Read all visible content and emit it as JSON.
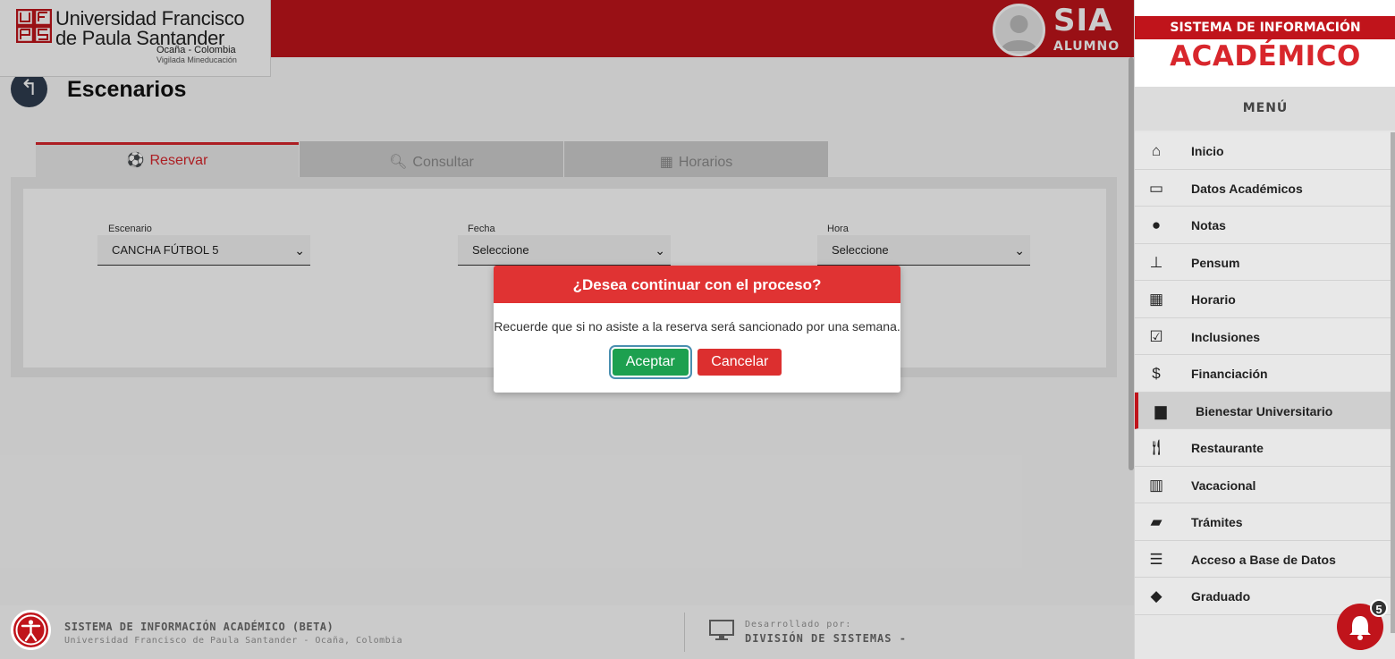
{
  "header": {
    "logo_lines": [
      "Universidad Francisco",
      "de Paula Santander",
      "Ocaña - Colombia",
      "Vigilada Mineducación"
    ],
    "logo_mark": "UFPS",
    "app_name": "SIA",
    "app_role": "ALUMNO",
    "brand_red": "#c0141b"
  },
  "page": {
    "title": "Escenarios",
    "tabs": [
      {
        "label": "Reservar",
        "icon": "soccer-ball-icon",
        "active": true
      },
      {
        "label": "Consultar",
        "icon": "search-icon",
        "active": false
      },
      {
        "label": "Horarios",
        "icon": "calendar-icon",
        "active": false
      }
    ],
    "form": {
      "escenario": {
        "label": "Escenario",
        "value": "CANCHA FÚTBOL 5"
      },
      "fecha": {
        "label": "Fecha",
        "value": "Seleccione"
      },
      "hora": {
        "label": "Hora",
        "value": "Seleccione"
      }
    }
  },
  "modal": {
    "title": "¿Desea continuar con el proceso?",
    "message": "Recuerde que si no asiste a la reserva será sancionado por una semana.",
    "accept_label": "Aceptar",
    "cancel_label": "Cancelar",
    "accept_color": "#1da04f",
    "cancel_color": "#dc2f2f"
  },
  "footer": {
    "title": "SISTEMA DE INFORMACIÓN ACADÉMICO (BETA)",
    "subtitle": "Universidad Francisco de Paula Santander - Ocaña, Colombia",
    "dev_label": "Desarrollado por:",
    "dev_name": "DIVISIÓN DE SISTEMAS -"
  },
  "sidebar": {
    "system_title": "SISTEMA DE INFORMACIÓN",
    "system_sub": "ACADÉMICO",
    "menu_title": "MENÚ",
    "items": [
      {
        "label": "Inicio",
        "icon": "home-icon"
      },
      {
        "label": "Datos Académicos",
        "icon": "id-card-icon"
      },
      {
        "label": "Notas",
        "icon": "medal-icon"
      },
      {
        "label": "Pensum",
        "icon": "sitemap-icon"
      },
      {
        "label": "Horario",
        "icon": "calendar-icon"
      },
      {
        "label": "Inclusiones",
        "icon": "checkbox-icon"
      },
      {
        "label": "Financiación",
        "icon": "dollar-icon"
      },
      {
        "label": "Bienestar Universitario",
        "icon": "briefcase-icon",
        "active": true
      },
      {
        "label": "Restaurante",
        "icon": "utensils-icon"
      },
      {
        "label": "Vacacional",
        "icon": "books-icon"
      },
      {
        "label": "Trámites",
        "icon": "folder-open-icon"
      },
      {
        "label": "Acceso a Base de Datos",
        "icon": "database-icon"
      },
      {
        "label": "Graduado",
        "icon": "graduation-cap-icon"
      }
    ]
  },
  "notifications": {
    "count": "5"
  }
}
